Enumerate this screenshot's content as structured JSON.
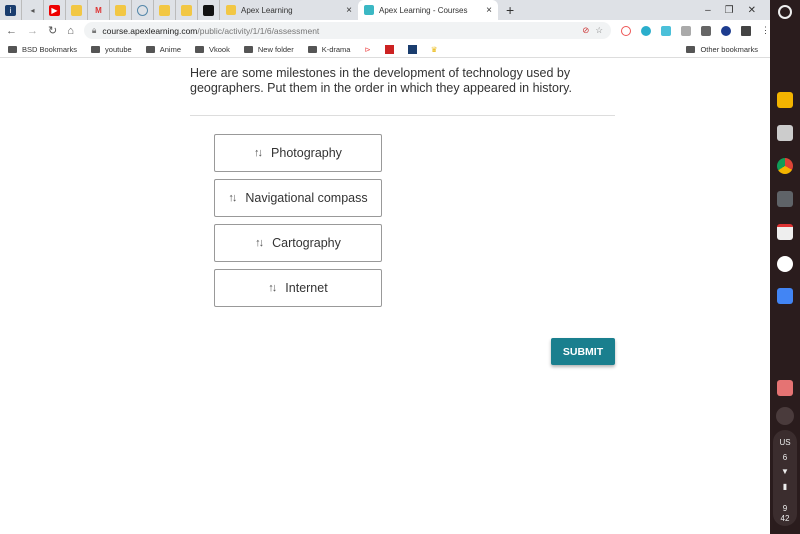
{
  "browser": {
    "tabs": [
      {
        "title": "Apex Learning",
        "active": false
      },
      {
        "title": "Apex Learning - Courses",
        "active": true
      }
    ],
    "new_tab": "+",
    "url_host": "course.apexlearning.com",
    "url_path": "/public/activity/1/1/6/assessment",
    "bookmarks": [
      "BSD Bookmarks",
      "youtube",
      "Anime",
      "Vkook",
      "New folder",
      "K-drama"
    ],
    "other_bookmarks": "Other bookmarks"
  },
  "question": {
    "text": "Here are some milestones in the development of technology used by geographers. Put them in the order in which they appeared in history."
  },
  "items": [
    {
      "label": "Photography"
    },
    {
      "label": "Navigational compass"
    },
    {
      "label": "Cartography"
    },
    {
      "label": "Internet"
    }
  ],
  "submit_label": "SUBMIT",
  "shelf": {
    "locale": "US",
    "notifications": "6",
    "time_hour": "9",
    "time_min": "42"
  },
  "colors": {
    "accent": "#1a7f8e",
    "shelf": "#2a1c1d"
  }
}
